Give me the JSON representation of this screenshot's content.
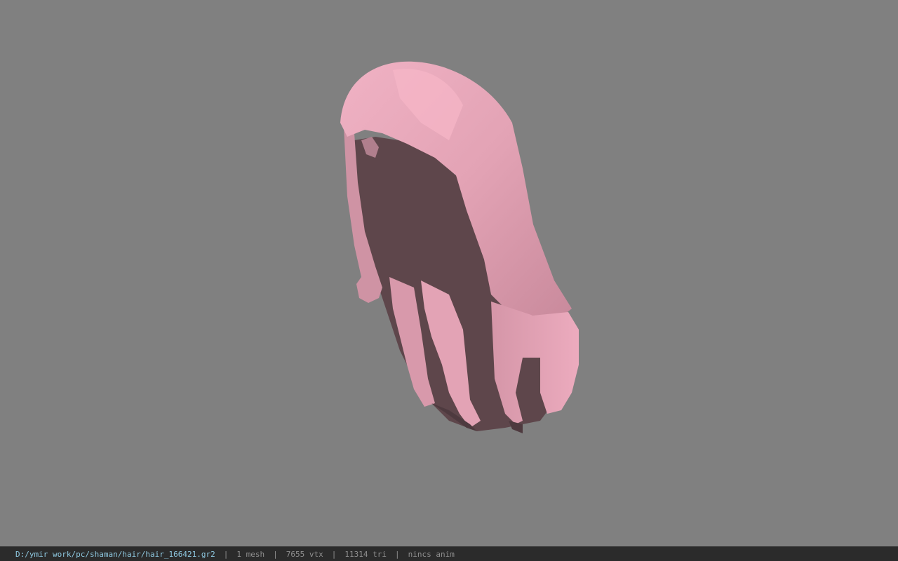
{
  "viewport": {
    "background_color": "#808080",
    "model_color": "#e9a8bb",
    "model_shadow_color": "#5e464b"
  },
  "status_bar": {
    "file_path": "D:/ymir work/pc/shaman/hair/hair_166421.gr2",
    "separator": "|",
    "mesh_count": "1 mesh",
    "vertex_count": "7655 vtx",
    "triangle_count": "11314 tri",
    "anim_status": "nincs anim"
  }
}
